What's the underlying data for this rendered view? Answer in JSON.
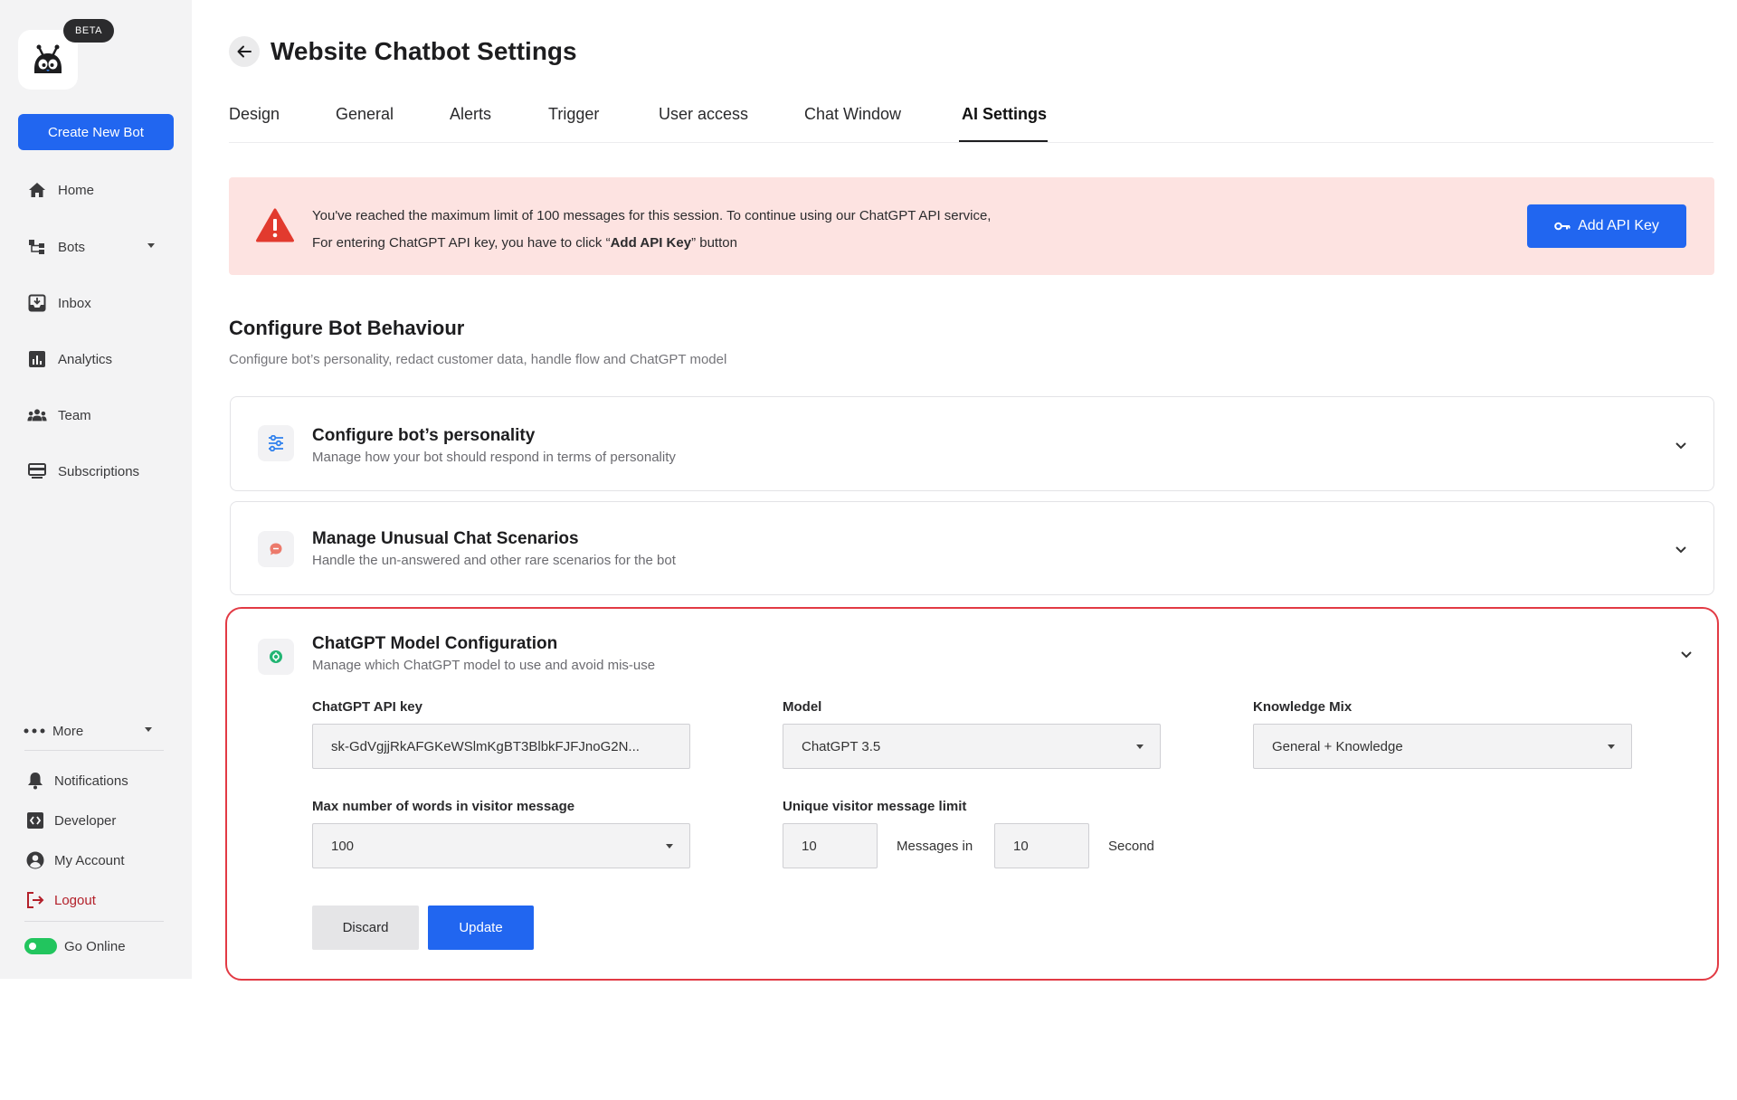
{
  "sidebar": {
    "beta": "BETA",
    "create_button": "Create New Bot",
    "nav": [
      {
        "label": "Home",
        "icon": "home-icon"
      },
      {
        "label": "Bots",
        "icon": "bots-icon"
      },
      {
        "label": "Inbox",
        "icon": "inbox-icon"
      },
      {
        "label": "Analytics",
        "icon": "analytics-icon"
      },
      {
        "label": "Team",
        "icon": "team-icon"
      },
      {
        "label": "Subscriptions",
        "icon": "subscriptions-icon"
      }
    ],
    "more": "More",
    "bottom": [
      {
        "label": "Notifications",
        "icon": "bell-icon"
      },
      {
        "label": "Developer",
        "icon": "code-icon"
      },
      {
        "label": "My Account",
        "icon": "account-icon"
      },
      {
        "label": "Logout",
        "icon": "logout-icon"
      }
    ],
    "go_online": "Go Online"
  },
  "header": {
    "title": "Website Chatbot Settings"
  },
  "tabs": [
    {
      "label": "Design"
    },
    {
      "label": "General"
    },
    {
      "label": "Alerts"
    },
    {
      "label": "Trigger"
    },
    {
      "label": "User access"
    },
    {
      "label": "Chat Window"
    },
    {
      "label": "AI Settings",
      "active": true
    }
  ],
  "alert": {
    "line1": "You've reached the maximum limit of 100 messages for this session. To continue using our ChatGPT API service,",
    "line2_prefix": "For entering ChatGPT API key, you have to click “",
    "line2_bold": "Add API Key",
    "line2_suffix": "” button",
    "button": "Add API Key",
    "color": "#fde3e1"
  },
  "section": {
    "title": "Configure Bot Behaviour",
    "subtitle": "Configure bot’s personality, redact customer data, handle flow and ChatGPT model"
  },
  "cards": [
    {
      "title": "Conﬁgure bot’s personality",
      "subtitle": "Manage how your bot should respond in terms of personality",
      "icon": "sliders-icon"
    },
    {
      "title": "Manage Unusual Chat Scenarios",
      "subtitle": "Handle the un-answered and other rare scenarios for the bot",
      "icon": "chat-bubble-icon"
    },
    {
      "title": "ChatGPT Model Configuration",
      "subtitle": "Manage which ChatGPT model to use and avoid mis-use",
      "icon": "chatgpt-icon"
    }
  ],
  "config": {
    "api_key_label": "ChatGPT API key",
    "api_key_value": "sk-GdVgjjRkAFGKeWSlmKgBT3BlbkFJFJnoG2N...",
    "model_label": "Model",
    "model_value": "ChatGPT 3.5",
    "knowledge_label": "Knowledge Mix",
    "knowledge_value": "General + Knowledge",
    "max_words_label": "Max number of words in visitor message",
    "max_words_value": "100",
    "limit_label": "Unique visitor message limit",
    "limit_messages": "10",
    "messages_in": "Messages in",
    "limit_seconds": "10",
    "second": "Second",
    "discard": "Discard",
    "update": "Update"
  },
  "colors": {
    "primary": "#2166f0",
    "highlight_border": "#e23a44",
    "online": "#22c55e"
  }
}
